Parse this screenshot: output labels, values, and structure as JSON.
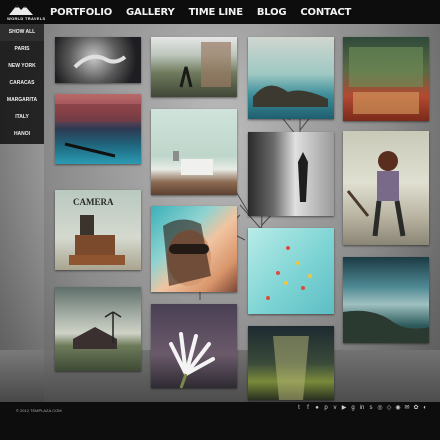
{
  "brand": {
    "name": "WORLD TRAVELS"
  },
  "nav": {
    "items": [
      "PORTFOLIO",
      "GALLERY",
      "TIME LINE",
      "BLOG",
      "CONTACT"
    ]
  },
  "sidebar": {
    "items": [
      "SHOW ALL",
      "PARIS",
      "NEW YORK",
      "CARACAS",
      "MARGARITA",
      "ITALY",
      "HANOI"
    ],
    "active_index": 0
  },
  "gallery": {
    "photos": [
      {
        "name": "photo-child-hands"
      },
      {
        "name": "photo-street-girl"
      },
      {
        "name": "photo-sea-rock-arch"
      },
      {
        "name": "photo-shop-window"
      },
      {
        "name": "photo-venice-canal"
      },
      {
        "name": "photo-rooftop-chimney"
      },
      {
        "name": "photo-child-window"
      },
      {
        "name": "photo-woman-bench"
      },
      {
        "name": "photo-camera-box"
      },
      {
        "name": "photo-woman-sunglasses"
      },
      {
        "name": "photo-balloons-sky"
      },
      {
        "name": "photo-old-house"
      },
      {
        "name": "photo-white-flower"
      },
      {
        "name": "photo-coast-cliff"
      },
      {
        "name": "photo-tunnel-corridor"
      }
    ],
    "camera_sign": "CAMERA"
  },
  "footer": {
    "copyright": "© 2012 TEMPLAZA.COM",
    "social_icons": [
      "twitter-icon",
      "facebook-icon",
      "flickr-icon",
      "pinterest-icon",
      "vimeo-icon",
      "youtube-icon",
      "googleplus-icon",
      "linkedin-icon",
      "skype-icon",
      "dribbble-icon",
      "deviantart-icon",
      "rss-icon",
      "email-icon",
      "myspace-icon",
      "lastfm-icon"
    ]
  },
  "colors": {
    "bar": "#0d0d0d",
    "text": "#f2f2f2"
  }
}
